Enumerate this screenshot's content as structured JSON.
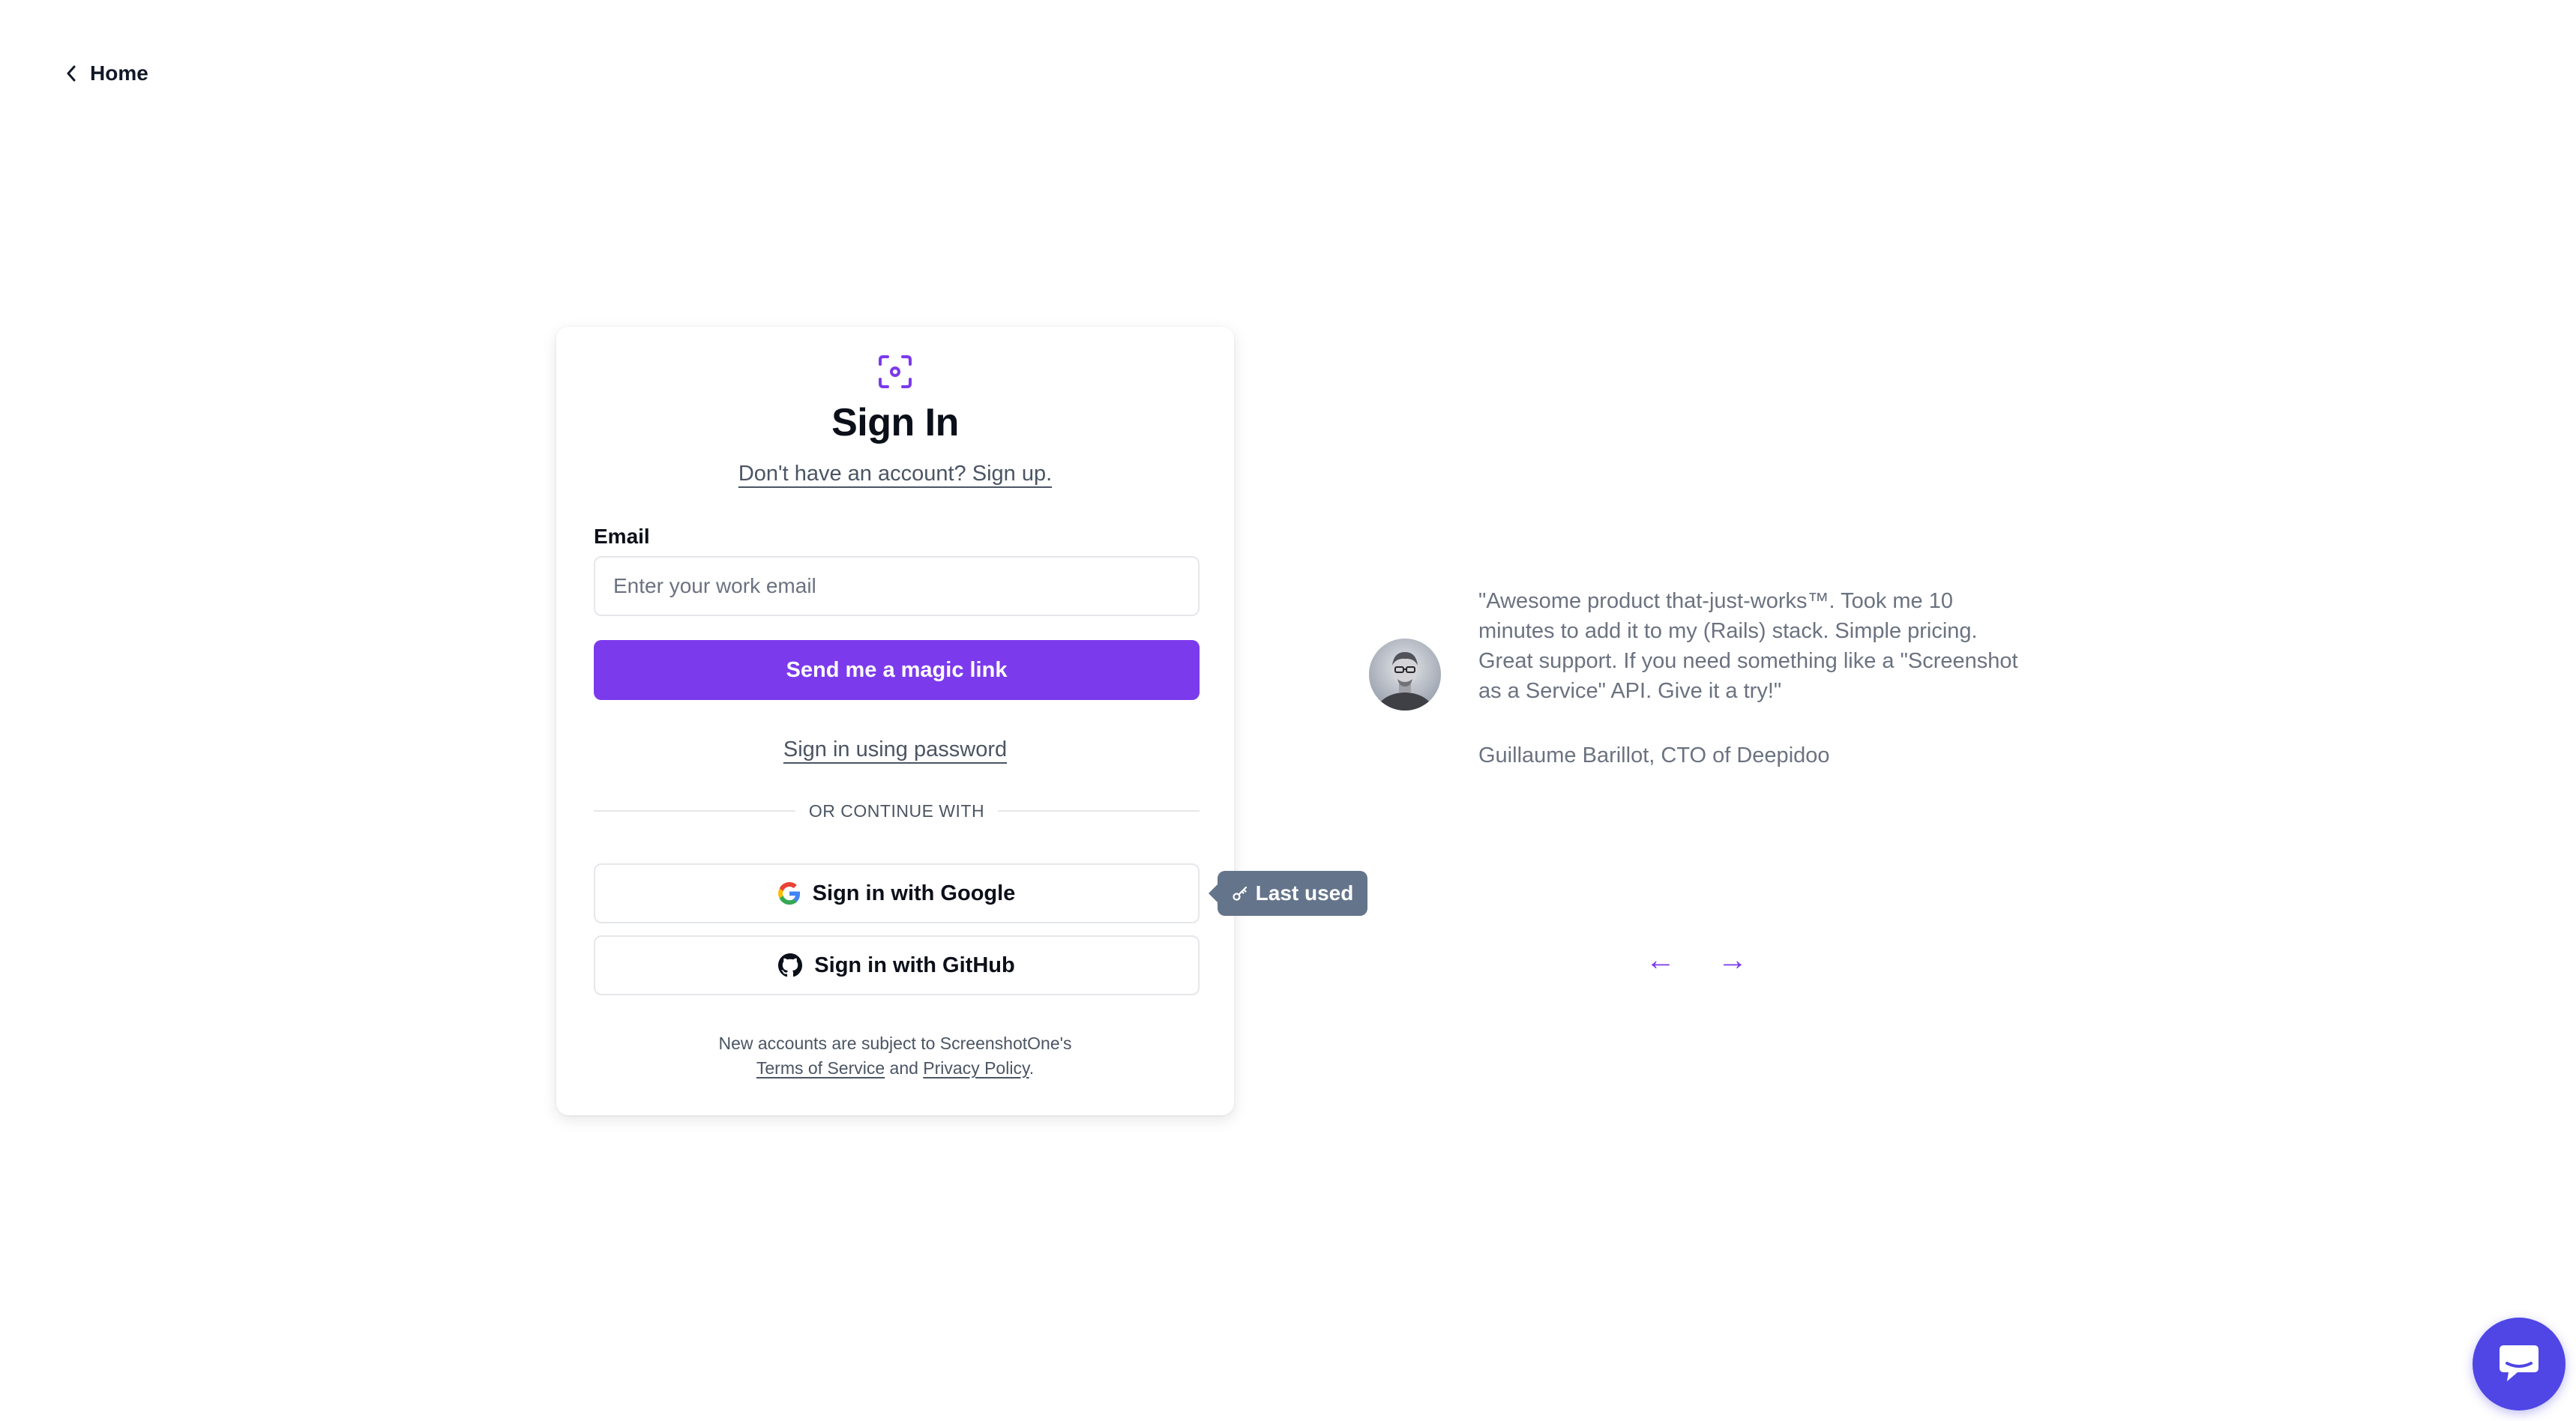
{
  "nav": {
    "home_label": "Home"
  },
  "signin": {
    "title": "Sign In",
    "signup_prompt": "Don't have an account? Sign up.",
    "email_label": "Email",
    "email_placeholder": "Enter your work email",
    "email_value": "",
    "magic_link_label": "Send me a magic link",
    "password_link": "Sign in using password",
    "divider_text": "OR CONTINUE WITH",
    "google_label": "Sign in with Google",
    "github_label": "Sign in with GitHub",
    "legal_prefix": "New accounts are subject to ScreenshotOne's",
    "terms_label": "Terms of Service",
    "legal_and": "and",
    "privacy_label": "Privacy Policy",
    "legal_suffix": "."
  },
  "last_used_badge": {
    "label": "Last used",
    "icon": "key-icon"
  },
  "testimonial": {
    "quote": "\"Awesome product that-just-works™. Took me 10 minutes to add it to my (Rails) stack. Simple pricing. Great support. If you need something like a \"Screenshot as a Service\" API. Give it a try!\"",
    "author": "Guillaume Barillot, CTO of Deepidoo",
    "prev_label": "←",
    "next_label": "→"
  },
  "colors": {
    "accent": "#7c3aed",
    "badge": "#64748b",
    "chat": "#4f46e5",
    "text_muted": "#6b7280"
  }
}
